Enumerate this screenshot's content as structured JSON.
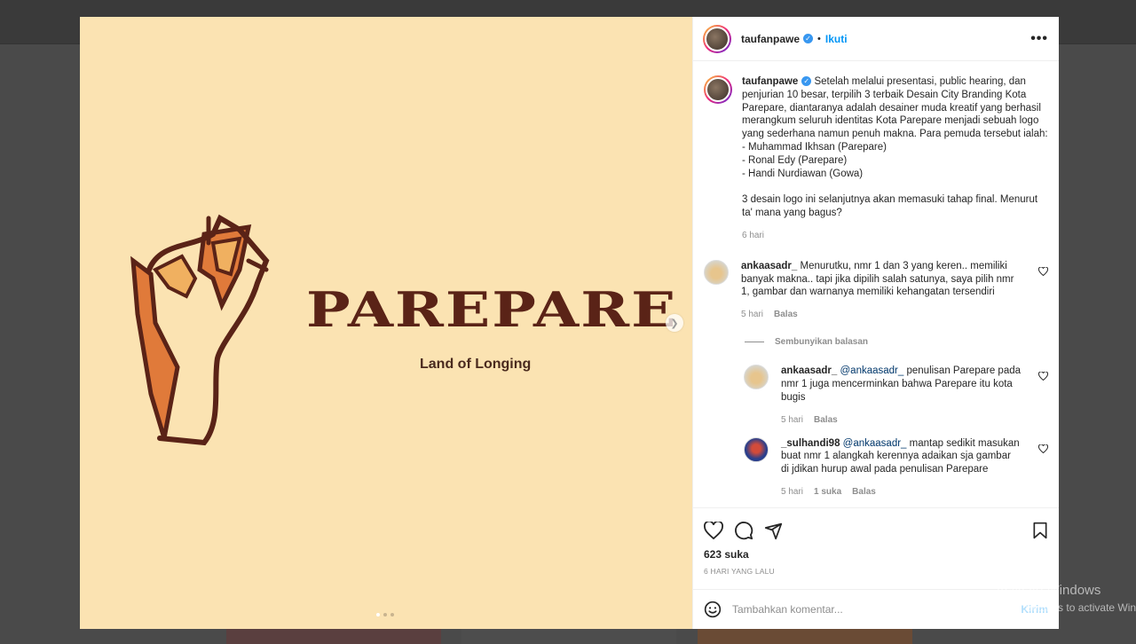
{
  "post": {
    "username": "taufanpawe",
    "follow_label": "Ikuti",
    "separator": "•",
    "more_label": "•••",
    "caption": "Setelah melalui presentasi, public hearing, dan penjurian 10 besar, terpilih 3 terbaik Desain City Branding Kota Parepare, diantaranya adalah desainer muda kreatif yang berhasil merangkum seluruh identitas Kota Parepare menjadi sebuah logo yang sederhana namun penuh makna. Para pemuda tersebut ialah:\n- Muhammad Ikhsan (Parepare)\n- Ronal Edy (Parepare)\n- Handi Nurdiawan (Gowa)\n\n3 desain logo ini selanjutnya akan memasuki tahap final. Menurut ta' mana yang bagus?",
    "caption_time": "6 hari",
    "likes": "623 suka",
    "posted": "6 HARI YANG LALU",
    "add_comment_placeholder": "Tambahkan komentar...",
    "post_label": "Kirim"
  },
  "image": {
    "wordmark": "PAREPARE",
    "tagline": "Land of Longing",
    "colors": {
      "background": "#FBE3B2",
      "brown": "#5A2317",
      "orange": "#E07A3A",
      "light_orange": "#F0B060"
    }
  },
  "comments": [
    {
      "username": "ankaasadr_",
      "text": "Menurutku, nmr 1 dan 3 yang keren.. memiliki banyak makna.. tapi jika dipilih salah satunya, saya pilih nmr 1, gambar dan warnanya memiliki kehangatan tersendiri",
      "time": "5 hari",
      "reply_label": "Balas"
    }
  ],
  "hide_replies_label": "Sembunyikan balasan",
  "replies": [
    {
      "username": "ankaasadr_",
      "mention": "@ankaasadr_",
      "text": "penulisan Parepare pada nmr 1 juga mencerminkan bahwa Parepare itu kota bugis",
      "time": "5 hari",
      "reply_label": "Balas"
    },
    {
      "username": "_sulhandi98",
      "mention": "@ankaasadr_",
      "text": "mantap sedikit masukan buat nmr 1 alangkah kerennya adaikan sja gambar di jdikan hurup awal pada penulisan Parepare",
      "time": "5 hari",
      "likes": "1 suka",
      "reply_label": "Balas"
    }
  ],
  "windows_watermark": {
    "title": "Activate Windows",
    "subtitle": "Go to Settings to activate Windows."
  },
  "icons": [
    "verified-badge-icon",
    "heart-icon",
    "comment-icon",
    "share-icon",
    "bookmark-icon",
    "emoji-icon",
    "chevron-right-icon"
  ]
}
